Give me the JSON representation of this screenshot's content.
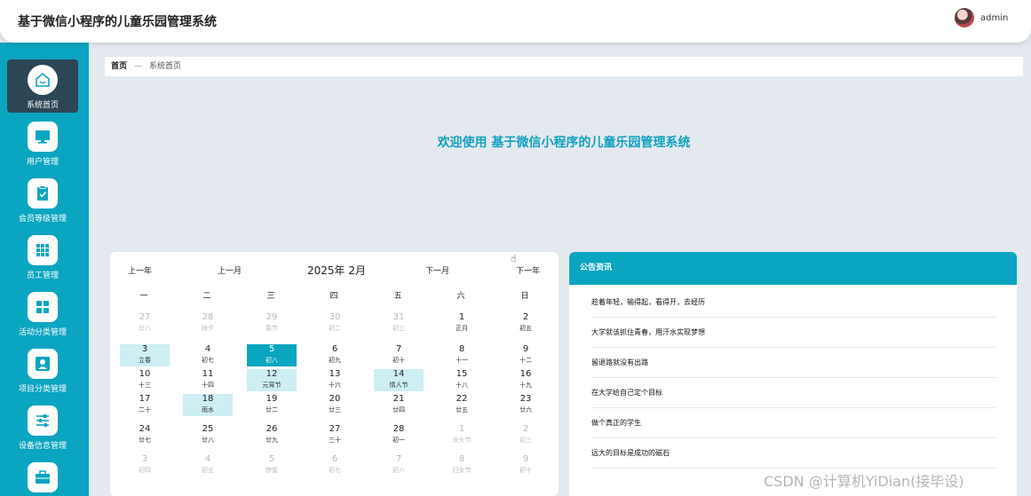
{
  "header": {
    "title": "基于微信小程序的儿童乐园管理系统",
    "user": "admin"
  },
  "sidebar": {
    "items": [
      {
        "label": "系统首页",
        "icon": "home-icon"
      },
      {
        "label": "用户管理",
        "icon": "monitor-icon"
      },
      {
        "label": "会员等级管理",
        "icon": "clipboard-check-icon"
      },
      {
        "label": "员工管理",
        "icon": "grid-icon"
      },
      {
        "label": "活动分类管理",
        "icon": "apps-icon"
      },
      {
        "label": "项目分类管理",
        "icon": "person-icon"
      },
      {
        "label": "设备信息管理",
        "icon": "sliders-icon"
      },
      {
        "label": "",
        "icon": "briefcase-icon"
      }
    ],
    "accent": "#0aa5c0",
    "active_bg": "#2d4656"
  },
  "breadcrumb": {
    "home": "首页",
    "sep": "—",
    "current": "系统首页"
  },
  "welcome": "欢迎使用 基于微信小程序的儿童乐园管理系统",
  "calendar": {
    "prev_year": "上一年",
    "prev_month": "上一月",
    "title": "2025年 2月",
    "next_month": "下一月",
    "next_year": "下一年",
    "weekdays": [
      "一",
      "二",
      "三",
      "四",
      "五",
      "六",
      "日"
    ],
    "weeks": [
      [
        {
          "d": "27",
          "l": "廿八",
          "t": "other"
        },
        {
          "d": "28",
          "l": "除夕",
          "t": "other"
        },
        {
          "d": "29",
          "l": "春节",
          "t": "other"
        },
        {
          "d": "30",
          "l": "初二",
          "t": "other"
        },
        {
          "d": "31",
          "l": "初三",
          "t": "other"
        },
        {
          "d": "1",
          "l": "正月",
          "t": ""
        },
        {
          "d": "2",
          "l": "初五",
          "t": ""
        }
      ],
      [
        {
          "d": "3",
          "l": "立春",
          "t": "festival"
        },
        {
          "d": "4",
          "l": "初七",
          "t": ""
        },
        {
          "d": "5",
          "l": "初八",
          "t": "today"
        },
        {
          "d": "6",
          "l": "初九",
          "t": ""
        },
        {
          "d": "7",
          "l": "初十",
          "t": ""
        },
        {
          "d": "8",
          "l": "十一",
          "t": ""
        },
        {
          "d": "9",
          "l": "十二",
          "t": ""
        }
      ],
      [
        {
          "d": "10",
          "l": "十三",
          "t": ""
        },
        {
          "d": "11",
          "l": "十四",
          "t": ""
        },
        {
          "d": "12",
          "l": "元宵节",
          "t": "festival"
        },
        {
          "d": "13",
          "l": "十六",
          "t": ""
        },
        {
          "d": "14",
          "l": "情人节",
          "t": "festival"
        },
        {
          "d": "15",
          "l": "十八",
          "t": ""
        },
        {
          "d": "16",
          "l": "十九",
          "t": ""
        }
      ],
      [
        {
          "d": "17",
          "l": "二十",
          "t": ""
        },
        {
          "d": "18",
          "l": "雨水",
          "t": "festival"
        },
        {
          "d": "19",
          "l": "廿二",
          "t": ""
        },
        {
          "d": "20",
          "l": "廿三",
          "t": ""
        },
        {
          "d": "21",
          "l": "廿四",
          "t": ""
        },
        {
          "d": "22",
          "l": "廿五",
          "t": ""
        },
        {
          "d": "23",
          "l": "廿六",
          "t": ""
        }
      ],
      [
        {
          "d": "24",
          "l": "廿七",
          "t": ""
        },
        {
          "d": "25",
          "l": "廿八",
          "t": ""
        },
        {
          "d": "26",
          "l": "廿九",
          "t": ""
        },
        {
          "d": "27",
          "l": "三十",
          "t": ""
        },
        {
          "d": "28",
          "l": "初一",
          "t": ""
        },
        {
          "d": "1",
          "l": "龙头节",
          "t": "other"
        },
        {
          "d": "2",
          "l": "初三",
          "t": "other"
        }
      ],
      [
        {
          "d": "3",
          "l": "初四",
          "t": "other"
        },
        {
          "d": "4",
          "l": "初五",
          "t": "other"
        },
        {
          "d": "5",
          "l": "惊蛰",
          "t": "other"
        },
        {
          "d": "6",
          "l": "初七",
          "t": "other"
        },
        {
          "d": "7",
          "l": "初八",
          "t": "other"
        },
        {
          "d": "8",
          "l": "妇女节",
          "t": "other"
        },
        {
          "d": "9",
          "l": "初十",
          "t": "other"
        }
      ]
    ]
  },
  "notice": {
    "title": "公告资讯",
    "items": [
      "趁着年轻，输得起，看得开，去经历",
      "大学就该抓住青春，用汗水实现梦想",
      "留退路就没有出路",
      "在大学给自己定个目标",
      "做个真正的学生",
      "远大的目标是成功的磁石"
    ]
  },
  "watermark": "CSDN @计算机YiDian(接毕设)"
}
